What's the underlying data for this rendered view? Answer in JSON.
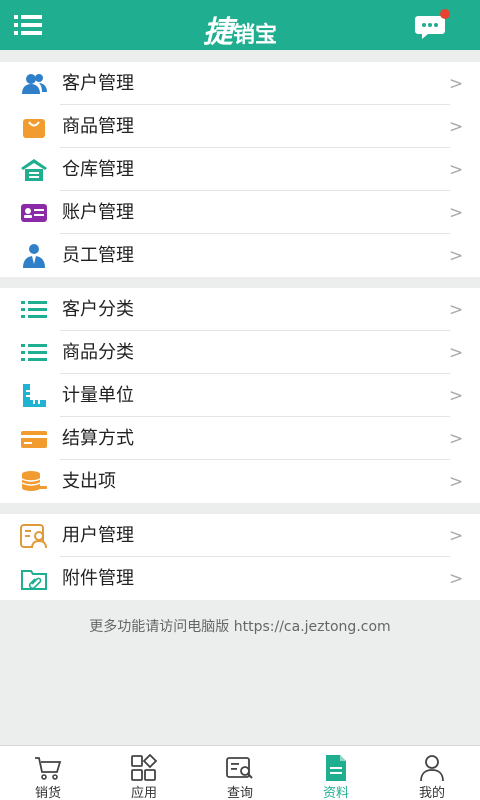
{
  "header": {
    "logo_part1": "捷",
    "logo_part2": "销宝",
    "menu_icon": "hamburger-menu-icon",
    "message_icon": "chat-bubble-icon",
    "accent_color": "#1fae8f",
    "badge_color": "#e8412f"
  },
  "menu_groups": [
    {
      "items": [
        {
          "label": "客户管理",
          "icon": "customers-icon",
          "color": "#2f80c8"
        },
        {
          "label": "商品管理",
          "icon": "shopping-bag-icon",
          "color": "#f29b2f"
        },
        {
          "label": "仓库管理",
          "icon": "warehouse-icon",
          "color": "#1fae8f"
        },
        {
          "label": "账户管理",
          "icon": "id-card-icon",
          "color": "#8a2aa8"
        },
        {
          "label": "员工管理",
          "icon": "employee-icon",
          "color": "#2f80c8"
        }
      ]
    },
    {
      "items": [
        {
          "label": "客户分类",
          "icon": "list-icon",
          "color": "#1fae8f"
        },
        {
          "label": "商品分类",
          "icon": "list-icon",
          "color": "#1fae8f"
        },
        {
          "label": "计量单位",
          "icon": "ruler-icon",
          "color": "#1fb3d1"
        },
        {
          "label": "结算方式",
          "icon": "credit-card-icon",
          "color": "#f29b2f"
        },
        {
          "label": "支出项",
          "icon": "coins-icon",
          "color": "#f29b2f"
        }
      ]
    },
    {
      "items": [
        {
          "label": "用户管理",
          "icon": "user-profile-icon",
          "color": "#e09a3a"
        },
        {
          "label": "附件管理",
          "icon": "attachment-folder-icon",
          "color": "#1fae8f"
        }
      ]
    }
  ],
  "chevron": ">",
  "footer_note": "更多功能请访问电脑版 https://ca.jeztong.com",
  "tabs": [
    {
      "label": "销货",
      "icon": "cart-icon",
      "active": false
    },
    {
      "label": "应用",
      "icon": "apps-icon",
      "active": false
    },
    {
      "label": "查询",
      "icon": "search-doc-icon",
      "active": false
    },
    {
      "label": "资料",
      "icon": "document-icon",
      "active": true
    },
    {
      "label": "我的",
      "icon": "person-icon",
      "active": false
    }
  ]
}
